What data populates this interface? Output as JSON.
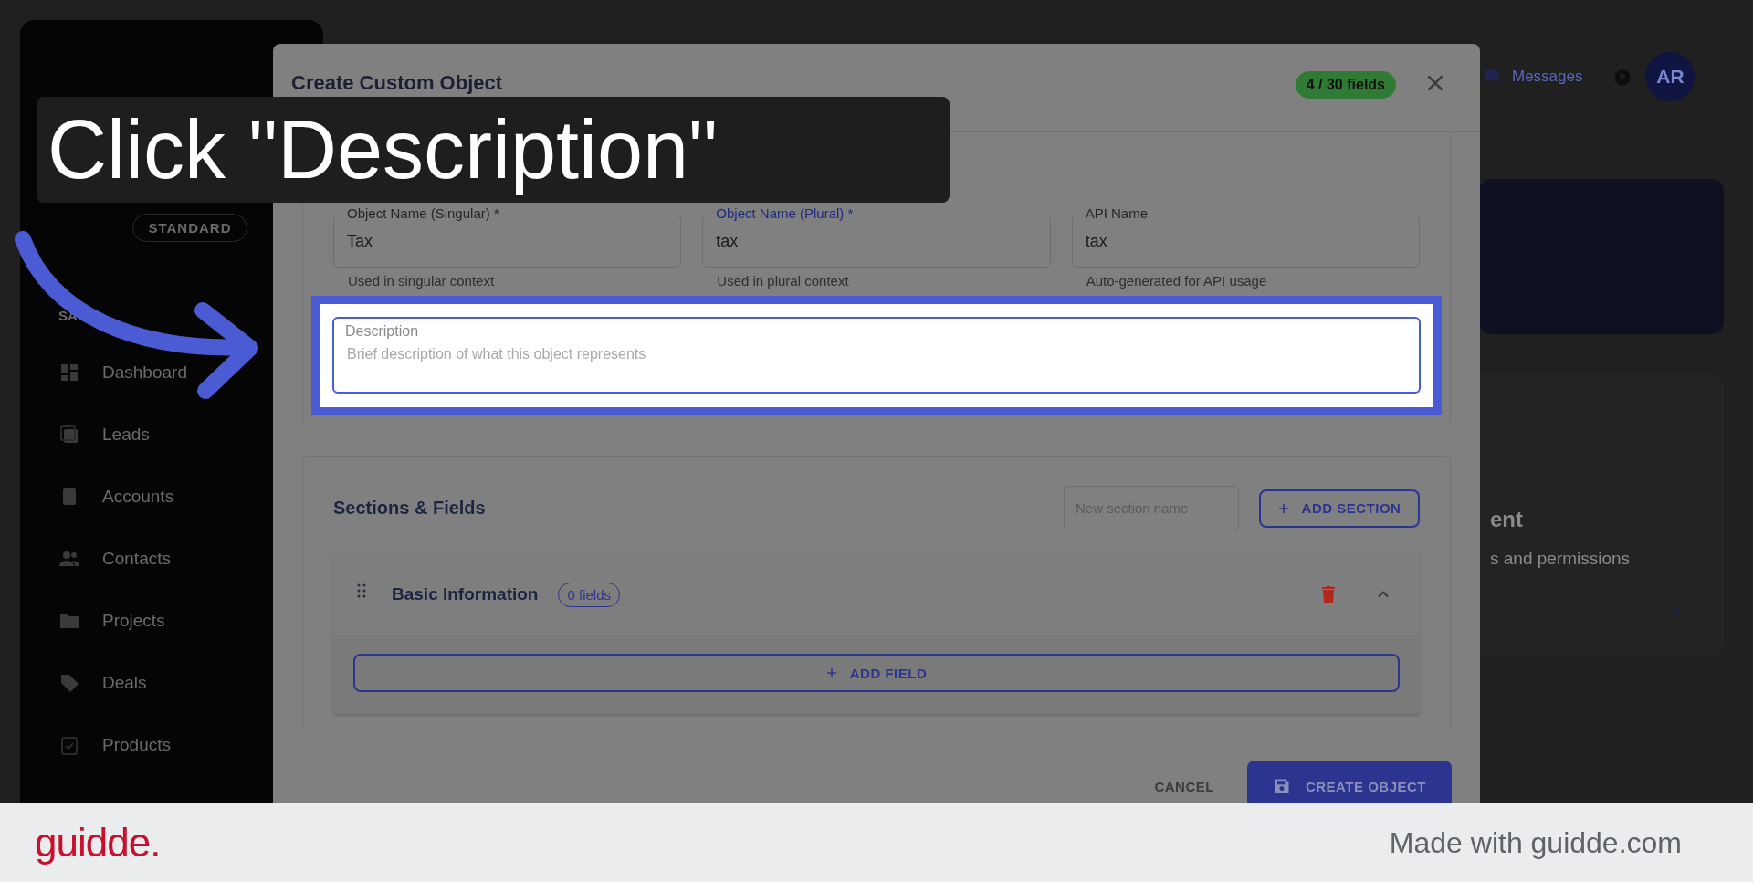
{
  "sidebar": {
    "badge": "STANDARD",
    "section_label": "SA",
    "items": [
      {
        "label": "Dashboard"
      },
      {
        "label": "Leads"
      },
      {
        "label": "Accounts"
      },
      {
        "label": "Contacts"
      },
      {
        "label": "Projects"
      },
      {
        "label": "Deals"
      },
      {
        "label": "Products"
      }
    ]
  },
  "top_bar": {
    "messages": "Messages",
    "avatar": "AR"
  },
  "background_card": {
    "title": "ent",
    "subtitle": "s and permissions"
  },
  "modal": {
    "title": "Create Custom Object",
    "field_count": "4 / 30 fields",
    "fields": [
      {
        "label": "Object Name (Singular) *",
        "value": "Tax",
        "helper": "Used in singular context",
        "focused": false
      },
      {
        "label": "Object Name (Plural) *",
        "value": "tax",
        "helper": "Used in plural context",
        "focused": true
      },
      {
        "label": "API Name",
        "value": "tax",
        "helper": "Auto-generated for API usage",
        "focused": false
      }
    ],
    "description": {
      "label": "Description",
      "placeholder": "Brief description of what this object represents"
    },
    "sections": {
      "title": "Sections & Fields",
      "new_section_placeholder": "New section name",
      "add_section": "ADD SECTION",
      "items": [
        {
          "title": "Basic Information",
          "count": "0 fields",
          "expanded": true,
          "add_field": "ADD FIELD"
        }
      ]
    },
    "cancel": "CANCEL",
    "create": "CREATE OBJECT"
  },
  "caption": "Click \"Description\"",
  "footer": {
    "logo": "guidde.",
    "credit": "Made with guidde.com"
  }
}
